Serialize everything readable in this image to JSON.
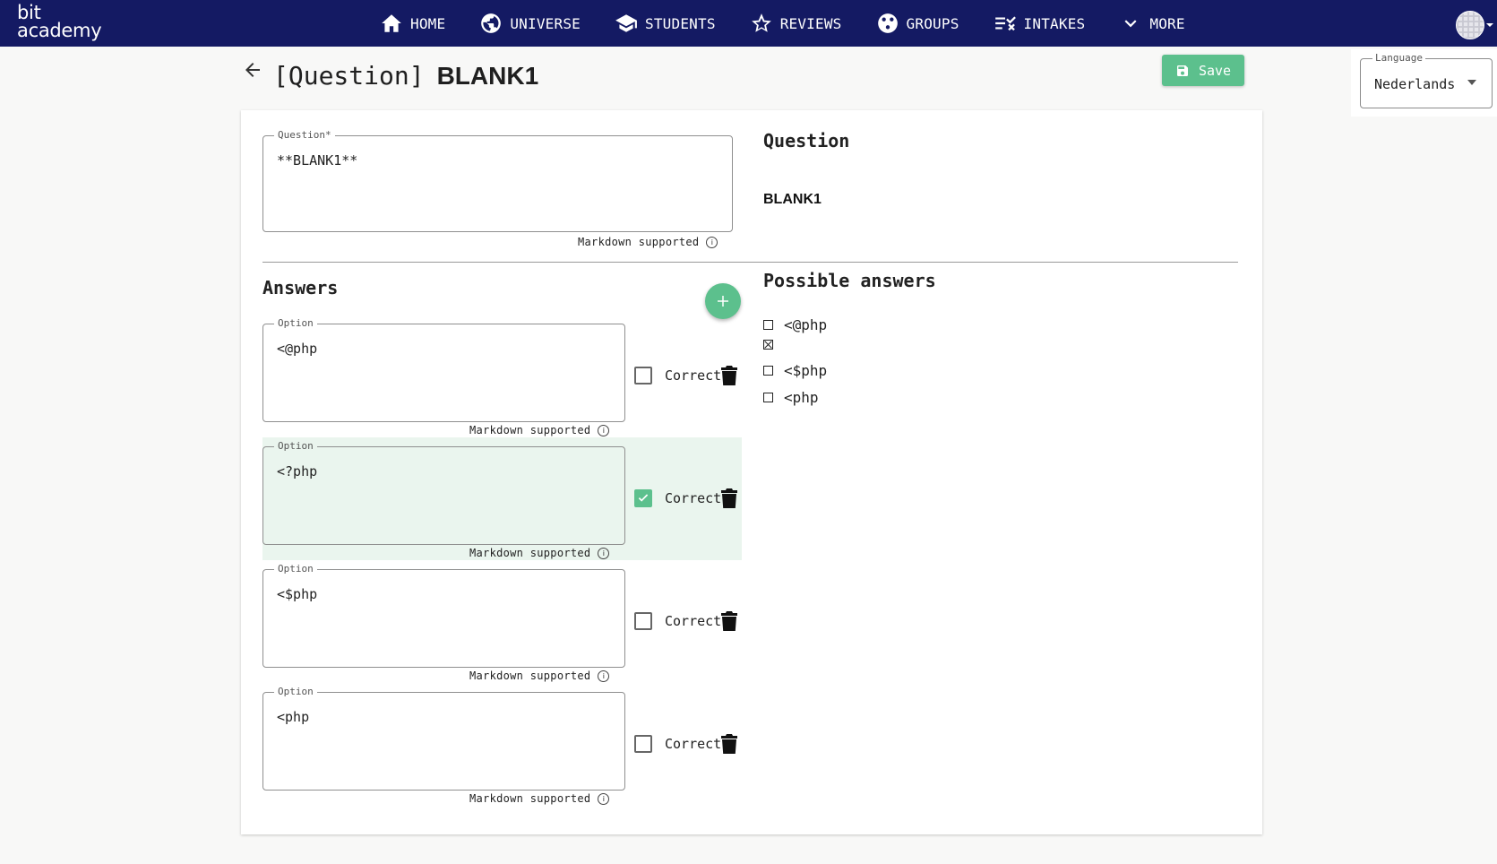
{
  "app": {
    "logo_line1": "bit",
    "logo_line2": "academy"
  },
  "nav": {
    "items": [
      {
        "label": "HOME",
        "icon": "home-icon"
      },
      {
        "label": "UNIVERSE",
        "icon": "globe-icon"
      },
      {
        "label": "STUDENTS",
        "icon": "graduation-cap-icon"
      },
      {
        "label": "REVIEWS",
        "icon": "star-icon"
      },
      {
        "label": "GROUPS",
        "icon": "groups-icon"
      },
      {
        "label": "INTAKES",
        "icon": "checklist-icon"
      },
      {
        "label": "MORE",
        "icon": "chevron-down-icon"
      }
    ]
  },
  "header": {
    "title_prefix": "[Question]",
    "title_name": "BLANK1",
    "save_label": "Save"
  },
  "language": {
    "legend": "Language",
    "value": "Nederlands"
  },
  "question": {
    "legend": "Question*",
    "value": "**BLANK1**",
    "markdown_note": "Markdown supported"
  },
  "answers": {
    "title": "Answers",
    "correct_label": "Correct",
    "option_legend": "Option",
    "markdown_note": "Markdown supported",
    "items": [
      {
        "value": "<@php",
        "correct": false
      },
      {
        "value": "<?php",
        "correct": true
      },
      {
        "value": "<$php",
        "correct": false
      },
      {
        "value": "<php",
        "correct": false
      }
    ]
  },
  "preview": {
    "question_title": "Question",
    "question_text": "BLANK1",
    "possible_title": "Possible answers",
    "possible": [
      {
        "text": "<@php",
        "checked": false
      },
      {
        "text": "",
        "checked": true
      },
      {
        "text": "<$php",
        "checked": false
      },
      {
        "text": "<php",
        "checked": false
      }
    ]
  },
  "colors": {
    "navbar": "#141a63",
    "accent_green": "#5cc08d",
    "selected_row": "#eaf5ee"
  }
}
